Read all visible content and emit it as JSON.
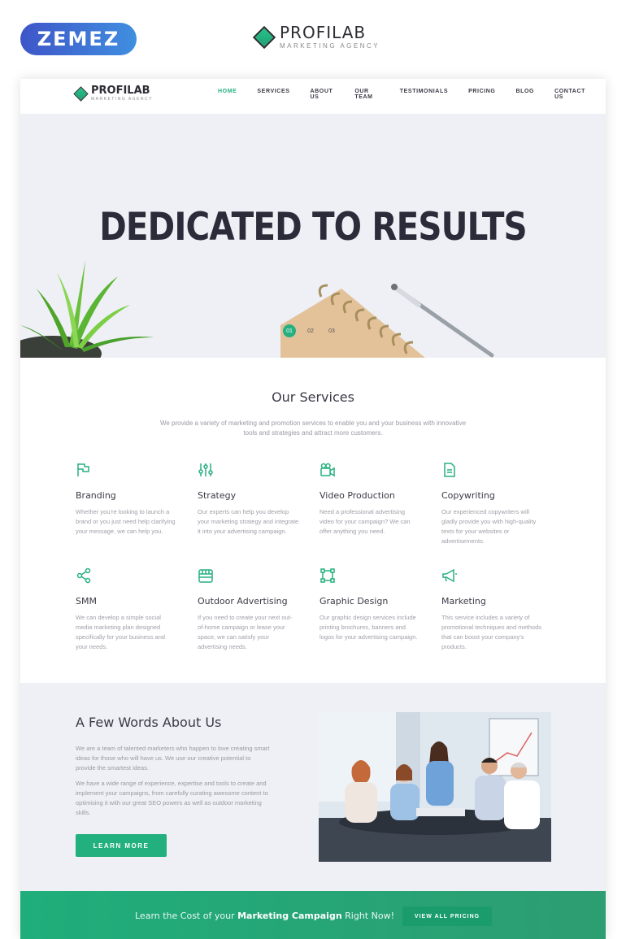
{
  "outer": {
    "zemez_logo": "ZEMEZ",
    "brand_name": "PROFILAB",
    "brand_tagline": "MARKETING AGENCY"
  },
  "nav": {
    "logo_name": "PROFILAB",
    "logo_tagline": "MARKETING AGENCY",
    "items": [
      {
        "label": "HOME",
        "active": true
      },
      {
        "label": "SERVICES"
      },
      {
        "label": "ABOUT US"
      },
      {
        "label": "OUR TEAM"
      },
      {
        "label": "TESTIMONIALS"
      },
      {
        "label": "PRICING"
      },
      {
        "label": "BLOG"
      },
      {
        "label": "CONTACT US"
      }
    ]
  },
  "hero": {
    "heading": "DEDICATED TO RESULTS",
    "slides": [
      "01",
      "02",
      "03"
    ],
    "active_slide": "01"
  },
  "services": {
    "title": "Our Services",
    "intro": "We provide a variety of marketing and promotion services to enable you and your business with innovative tools and strategies and attract more customers.",
    "items": [
      {
        "title": "Branding",
        "icon": "flag-icon",
        "text": "Whether you're looking to launch a brand or you just need help clarifying your message, we can help you."
      },
      {
        "title": "Strategy",
        "icon": "sliders-icon",
        "text": "Our experts can help you develop your marketing strategy and integrate it into your advertising campaign."
      },
      {
        "title": "Video Production",
        "icon": "video-camera-icon",
        "text": "Need a professional advertising video for your campaign? We can offer anything you need."
      },
      {
        "title": "Copywriting",
        "icon": "document-icon",
        "text": "Our experienced copywriters will gladly provide you with high-quality texts for your websites or advertisements."
      },
      {
        "title": "SMM",
        "icon": "share-icon",
        "text": "We can develop a simple social media marketing plan designed specifically for your business and your needs."
      },
      {
        "title": "Outdoor Advertising",
        "icon": "storefront-icon",
        "text": "If you need to create your next out-of-home campaign or lease your space, we can satisfy your advertising needs."
      },
      {
        "title": "Graphic Design",
        "icon": "vector-square-icon",
        "text": "Our graphic design services include printing brochures, banners and logos for your advertising campaign."
      },
      {
        "title": "Marketing",
        "icon": "megaphone-icon",
        "text": "This service includes a variety of promotional techniques and methods that can boost your company's products."
      }
    ]
  },
  "about": {
    "title": "A Few Words About Us",
    "p1": "We are a team of talented marketers who happen to love creating smart ideas for those who will have us. We use our creative potential to provide the smartest ideas.",
    "p2": "We have a wide range of experience, expertise and tools to create and implement your campaigns, from carefully curating awesome content to optimising it with our great SEO powers as well as outdoor marketing skills.",
    "button": "LEARN MORE"
  },
  "cta": {
    "text_before": "Learn the Cost of your ",
    "text_bold": "Marketing Campaign",
    "text_after": " Right Now!",
    "button": "VIEW ALL PRICING"
  },
  "colors": {
    "accent": "#27b07f",
    "hero_bg": "#eef0f5",
    "heading": "#2b2b3a"
  }
}
